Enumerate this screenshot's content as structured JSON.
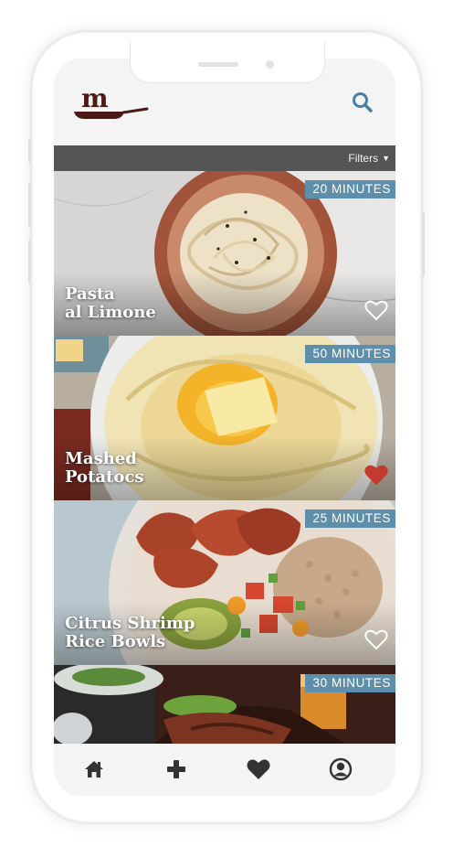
{
  "app": {
    "logo_letter": "m"
  },
  "filters": {
    "label": "Filters"
  },
  "recipes": [
    {
      "title_line1": "Pasta",
      "title_line2": "al Limone",
      "time": "20 MINUTES",
      "favorited": false
    },
    {
      "title_line1": "Mashed",
      "title_line2": "Potatocs",
      "time": "50 MINUTES",
      "favorited": true
    },
    {
      "title_line1": "Citrus Shrimp",
      "title_line2": "Rice Bowls",
      "time": "25 MINUTES",
      "favorited": false
    },
    {
      "title_line1": "",
      "title_line2": "",
      "time": "30 MINUTES",
      "favorited": false
    }
  ],
  "colors": {
    "accent": "#4a7fa5",
    "badge": "#5d8fac",
    "brand_dark": "#4b1a14",
    "favorite_active": "#c43a2f",
    "filter_bar": "#555555",
    "nav_icon": "#333333"
  },
  "nav": {
    "items": [
      {
        "icon": "home-icon"
      },
      {
        "icon": "plus-icon"
      },
      {
        "icon": "heart-icon"
      },
      {
        "icon": "user-icon"
      }
    ]
  }
}
